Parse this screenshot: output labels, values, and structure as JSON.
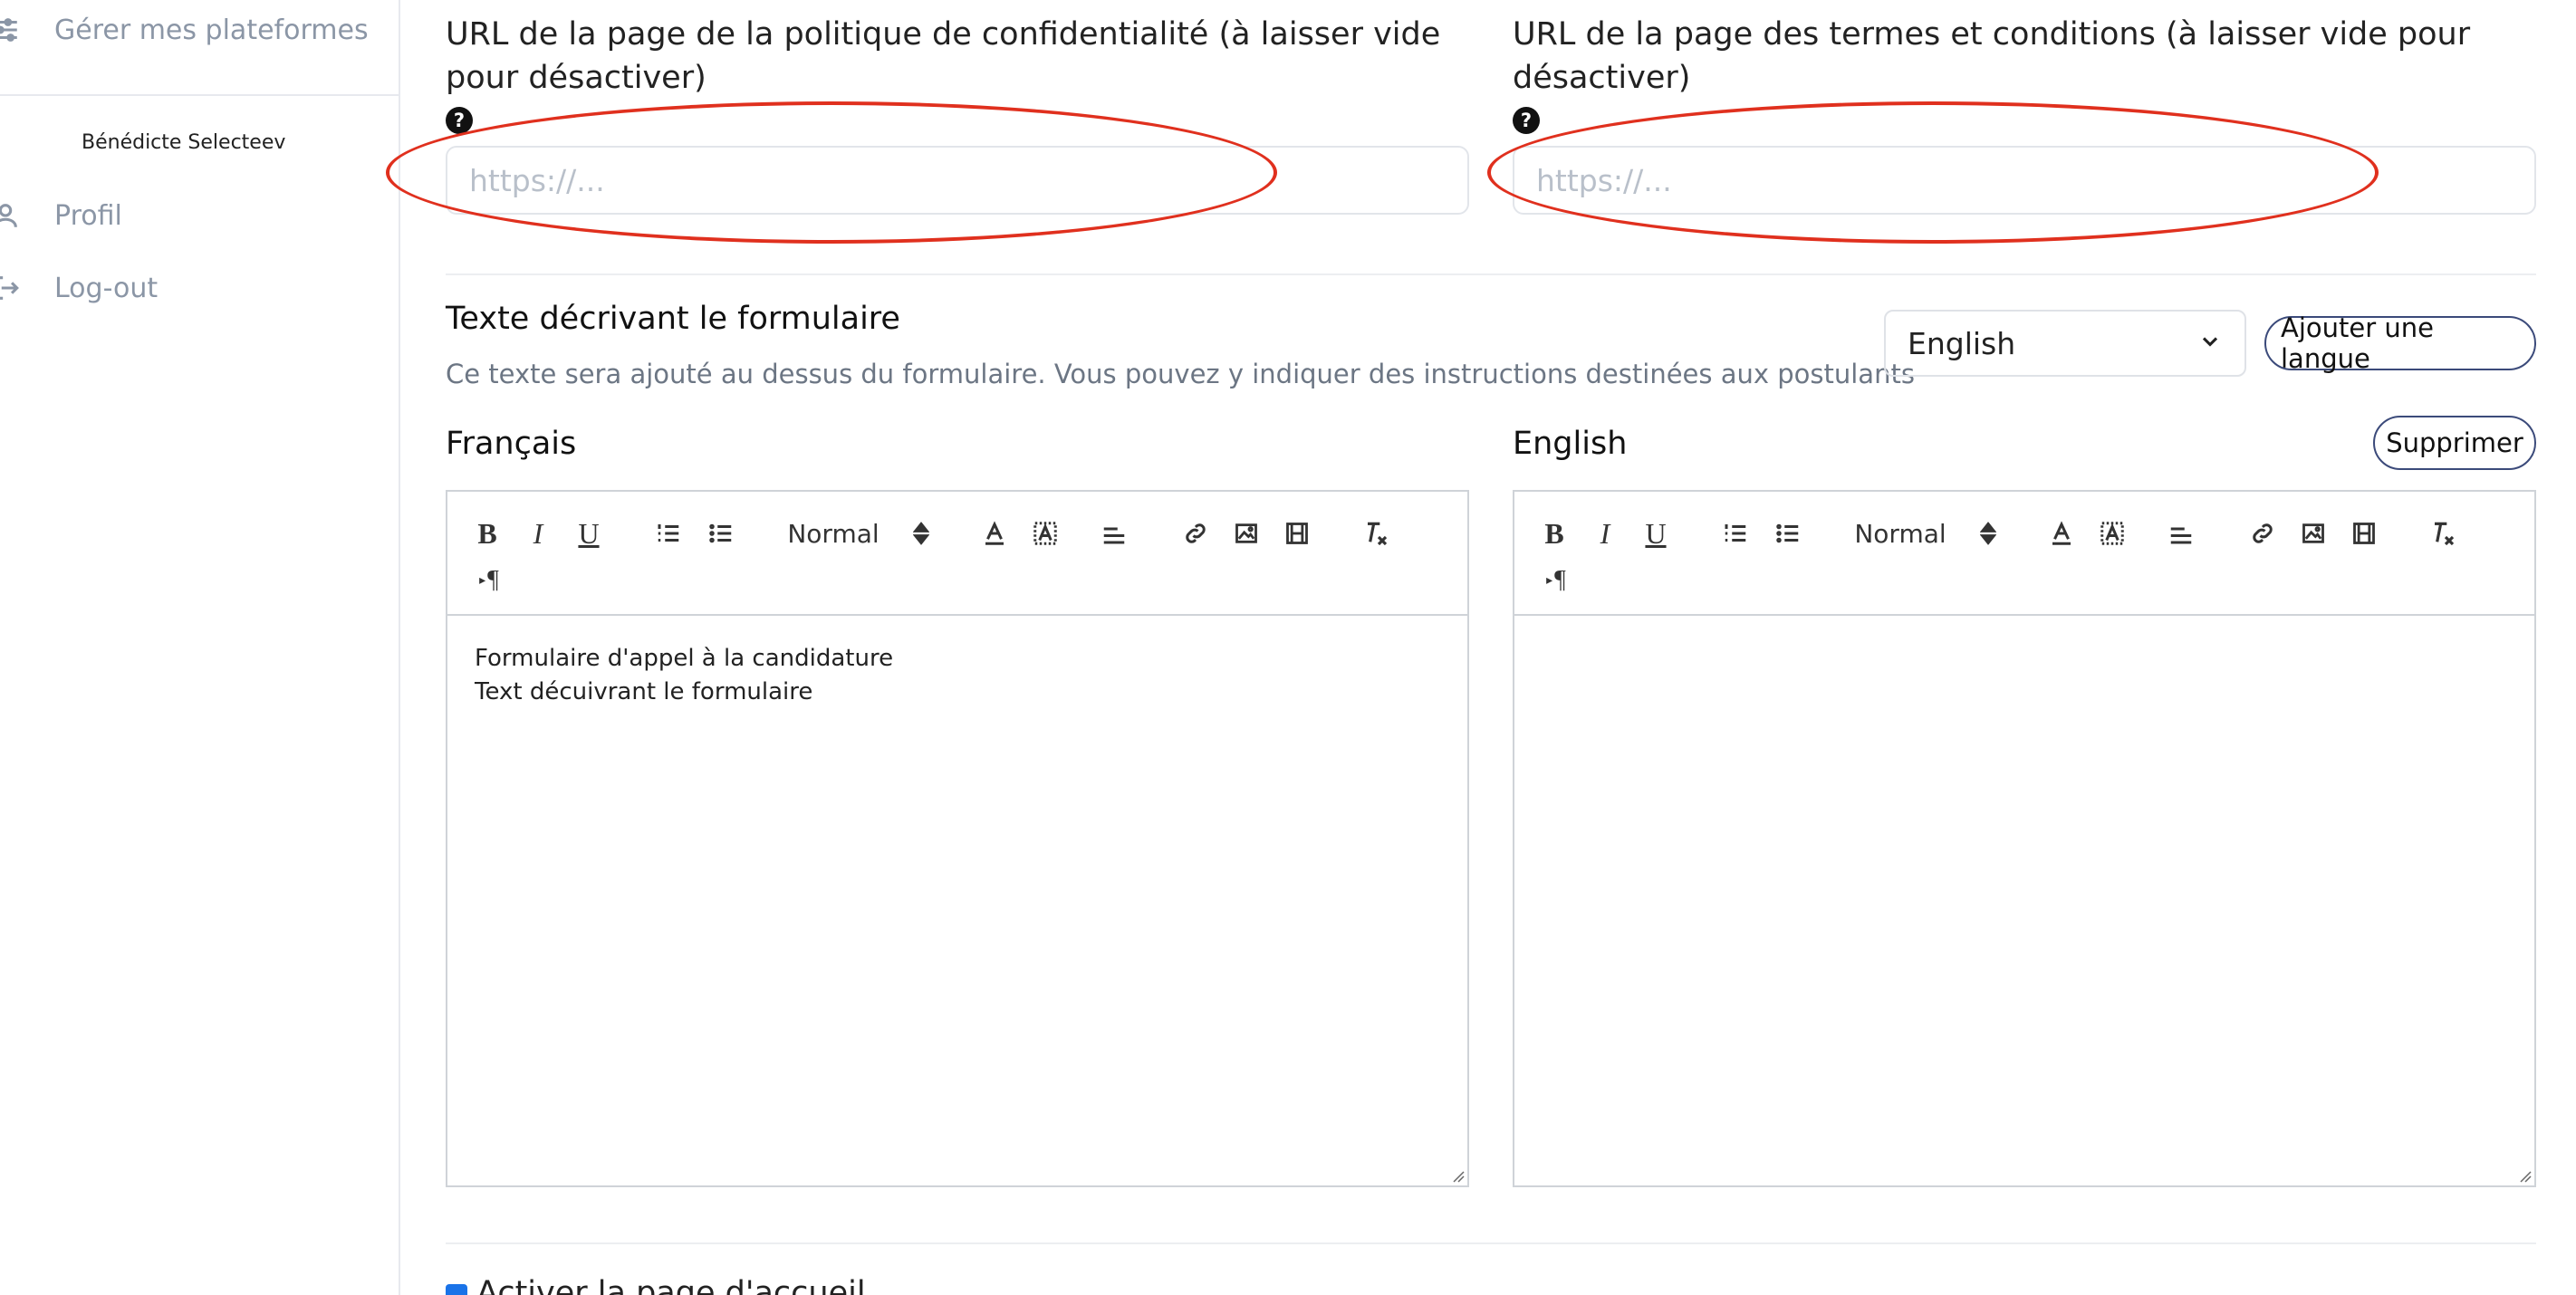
{
  "sidebar": {
    "items": [
      {
        "label": "Gérer mes plateformes",
        "icon": "sliders-icon"
      },
      {
        "label": "Profil",
        "icon": "user-icon"
      },
      {
        "label": "Log-out",
        "icon": "logout-icon"
      }
    ],
    "user_name": "Bénédicte Selecteev"
  },
  "privacy": {
    "label": "URL de la page de la politique de confidentialité (à laisser vide pour désactiver)",
    "placeholder": "https://...",
    "value": ""
  },
  "terms": {
    "label": "URL de la page des termes et conditions (à laisser vide pour désactiver)",
    "placeholder": "https://...",
    "value": ""
  },
  "form_description": {
    "title": "Texte décrivant le formulaire",
    "description": "Ce texte sera ajouté au dessus du formulaire. Vous pouvez y indiquer des instructions destinées aux postulants",
    "language_select": "English",
    "add_language_label": "Ajouter une langue",
    "delete_label": "Supprimer",
    "help_symbol": "?",
    "french": {
      "title": "Français",
      "lines": [
        "Formulaire d'appel à la candidature",
        "Text décuivrant le formulaire"
      ]
    },
    "english": {
      "title": "English",
      "lines": []
    },
    "toolbar": {
      "bold": "B",
      "italic": "I",
      "underline": "U",
      "header_select": "Normal",
      "direction": "¶"
    }
  },
  "homepage": {
    "label": "Activer la page d'accueil",
    "checked": true
  },
  "colors": {
    "highlight_ellipse": "#e0301e",
    "pill_border": "#3b4a7a",
    "checkbox": "#1a73e8"
  }
}
